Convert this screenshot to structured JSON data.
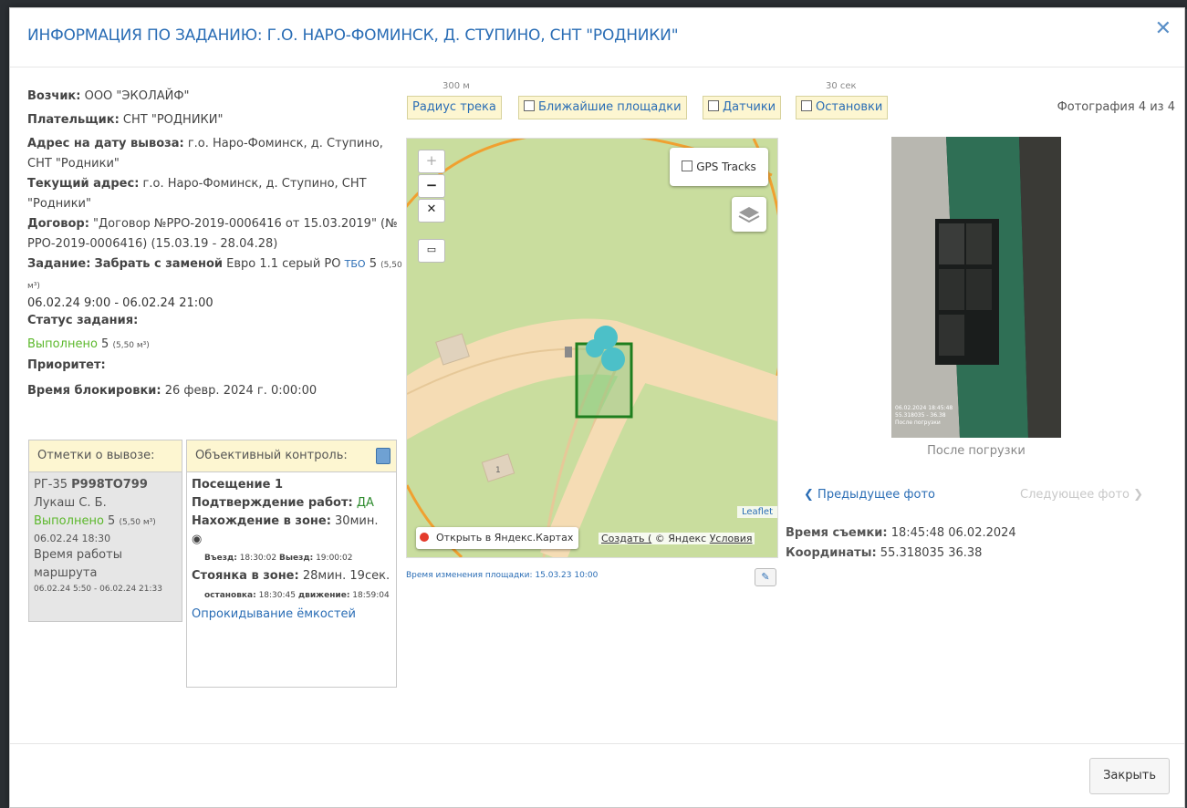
{
  "modal": {
    "title": "ИНФОРМАЦИЯ ПО ЗАДАНИЮ: Г.О. НАРО-ФОМИНСК, Д. СТУПИНО, СНТ \"РОДНИКИ\"",
    "close_icon": "close-icon"
  },
  "info": {
    "carrier_label": "Возчик:",
    "carrier_value": "ООО \"ЭКОЛАЙФ\"",
    "payer_label": "Плательщик:",
    "payer_value": "СНТ \"РОДНИКИ\"",
    "address_on_date_label": "Адрес на дату вывоза:",
    "address_on_date_value": "г.о. Наро-Фоминск, д. Ступино, СНТ \"Родники\"",
    "current_address_label": "Текущий адрес:",
    "current_address_value": "г.о. Наро-Фоминск, д. Ступино, СНТ \"Родники\"",
    "contract_label": "Договор:",
    "contract_value": "\"Договор №РРО-2019-0006416 от 15.03.2019\" (№ РРО-2019-0006416) (15.03.19 - 28.04.28)",
    "task_label": "Задание:",
    "task_action": "Забрать с заменой",
    "task_container": "Евро 1.1 серый РО",
    "task_type_link": "ТБО",
    "task_count": "5",
    "task_volume": "(5,50 м³)",
    "task_period": "06.02.24 9:00 - 06.02.24 21:00",
    "status_label": "Статус задания:",
    "status_value": "Выполнено",
    "status_count": "5",
    "status_volume": "(5,50 м³)",
    "priority_label": "Приоритет:",
    "lock_time_label": "Время блокировки:",
    "lock_time_value": "26 февр. 2024 г. 0:00:00"
  },
  "removal_marks": {
    "header": "Отметки о вывозе:",
    "route": "РГ-35",
    "plate": "Р998ТО799",
    "driver": "Лукаш С. Б.",
    "status": "Выполнено",
    "count": "5",
    "volume": "(5,50 м³)",
    "datetime": "06.02.24 18:30",
    "work_time_label": "Время работы маршрута",
    "work_time_value": "06.02.24 5:50 - 06.02.24 21:33"
  },
  "objective_control": {
    "header": "Объективный контроль:",
    "visit": "Посещение 1",
    "confirm_label": "Подтверждение работ:",
    "confirm_value": "ДА",
    "in_zone_label": "Нахождение в зоне:",
    "in_zone_value": "30мин.",
    "entry_label": "Въезд:",
    "entry_value": "18:30:02",
    "exit_label": "Выезд:",
    "exit_value": "19:00:02",
    "parking_label": "Стоянка в зоне:",
    "parking_value": "28мин. 19сек.",
    "stop_label": "остановка:",
    "stop_value": "18:30:45",
    "move_label": "движение:",
    "move_value": "18:59:04",
    "tipping_link": "Опрокидывание ёмкостей"
  },
  "toolbar": {
    "radius_hint": "300 м",
    "radius_label": "Радиус трека",
    "nearby_label": "Ближайшие площадки",
    "sensors_label": "Датчики",
    "stops_hint": "30 сек",
    "stops_label": "Остановки"
  },
  "map": {
    "zoom_in": "+",
    "zoom_out": "−",
    "gps_label": "GPS Tracks",
    "leaflet": "Leaflet",
    "open_yandex": "Открыть в Яндекс.Картах",
    "create_link": "Создать (",
    "copyright": "© Яндекс",
    "terms": "Условия",
    "building_label": "1",
    "site_changed": "Время изменения площадки: 15.03.23 10:00"
  },
  "photo": {
    "counter": "Фотография 4 из 4",
    "caption": "После погрузки",
    "prev": "Предыдущее фото",
    "next": "Следующее фото",
    "stamp_line1": "06.02.2024 18:45:48",
    "stamp_line2": "55.318035 - 36.38",
    "stamp_line3": "После погрузки",
    "shot_time_label": "Время съемки:",
    "shot_time_value": "18:45:48 06.02.2024",
    "coords_label": "Координаты:",
    "coords_value": "55.318035 36.38"
  },
  "footer": {
    "close_button": "Закрыть"
  }
}
